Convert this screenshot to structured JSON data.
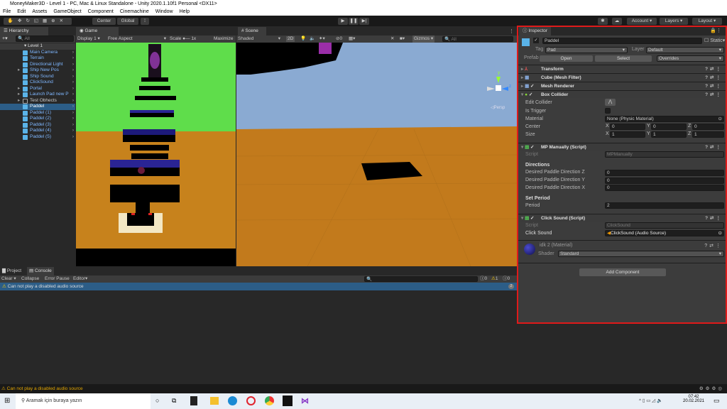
{
  "window": {
    "title": "MoneyMaker3D - Level 1 - PC, Mac & Linux Standalone - Unity 2020.1.10f1 Personal <DX11>"
  },
  "menu": [
    "File",
    "Edit",
    "Assets",
    "GameObject",
    "Component",
    "Cinemachine",
    "Window",
    "Help"
  ],
  "toolbar": {
    "pivot": "Center",
    "space": "Global",
    "account": "Account",
    "layers": "Layers",
    "layout": "Layout"
  },
  "hierarchy": {
    "tab": "Hierarchy",
    "search": "All",
    "scene": "Level 1",
    "items": [
      {
        "label": "Main Camera"
      },
      {
        "label": "Terrain"
      },
      {
        "label": "Directional Light"
      },
      {
        "label": "Ship New Pos"
      },
      {
        "label": "Ship Sound"
      },
      {
        "label": "ClickSound"
      },
      {
        "label": "Portal"
      },
      {
        "label": "Launch Pad new P"
      },
      {
        "label": "Test Obhects"
      },
      {
        "label": "Paddel"
      },
      {
        "label": "Paddel (1)"
      },
      {
        "label": "Paddel (2)"
      },
      {
        "label": "Paddel (3)"
      },
      {
        "label": "Paddel (4)"
      },
      {
        "label": "Paddel (5)"
      }
    ]
  },
  "game": {
    "tab": "Game",
    "display": "Display 1",
    "aspect": "Free Aspect",
    "scale_label": "Scale",
    "scale_value": "1x",
    "maximize": "Maximize"
  },
  "scene": {
    "tab": "Scene",
    "shading": "Shaded",
    "mode2d": "2D",
    "gizmos": "Gizmos",
    "search": "All",
    "persp": "Persp",
    "axis_y": "y",
    "axis_z": "z",
    "hidden_count": "0"
  },
  "inspector": {
    "tab": "Inspector",
    "name": "Paddel",
    "static": "Static",
    "tag_label": "Tag",
    "tag": "Pad",
    "layer_label": "Layer",
    "layer": "Default",
    "prefab_label": "Prefab",
    "open": "Open",
    "select": "Select",
    "overrides": "Overrides",
    "components": [
      "Transform",
      "Cube (Mesh Filter)",
      "Mesh Renderer",
      "Box Collider"
    ],
    "box_collider": {
      "edit_collider": "Edit Collider",
      "is_trigger": "Is Trigger",
      "material_label": "Material",
      "material": "None (Physic Material)",
      "center_label": "Center",
      "size_label": "Size",
      "center": {
        "x": "0",
        "y": "0",
        "z": "0"
      },
      "size": {
        "x": "1",
        "y": "1",
        "z": "1"
      }
    },
    "mp_manually": {
      "title": "MP Manually (Script)",
      "script_label": "Script",
      "script": "MPManually",
      "directions": "Directions",
      "dz_label": "Desired Paddle Direction Z",
      "dz": "0",
      "dy_label": "Desired Paddle Direction Y",
      "dy": "0",
      "dx_label": "Desired Paddle Direction X",
      "dx": "0",
      "set_period": "Set Period",
      "period_label": "Period",
      "period": "2"
    },
    "click_sound": {
      "title": "Click Sound (Script)",
      "script_label": "Script",
      "script": "ClickSound",
      "field_label": "Click Sound",
      "value": "ClickSound (Audio Source)"
    },
    "material": {
      "name": "idk 2 (Material)",
      "shader_label": "Shader",
      "shader": "Standard"
    },
    "add_component": "Add Component"
  },
  "console": {
    "tab_project": "Project",
    "tab_console": "Console",
    "clear": "Clear",
    "collapse": "Collapse",
    "error_pause": "Error Pause",
    "editor": "Editor",
    "count_info": "0",
    "count_warn": "1",
    "count_error": "0",
    "message": "Can not play a disabled audio source",
    "message_count": "2"
  },
  "status": {
    "message": "Can not play a disabled audio source"
  },
  "taskbar": {
    "search": "Aramak için buraya yazın",
    "time": "07:42",
    "date": "20.02.2021"
  }
}
